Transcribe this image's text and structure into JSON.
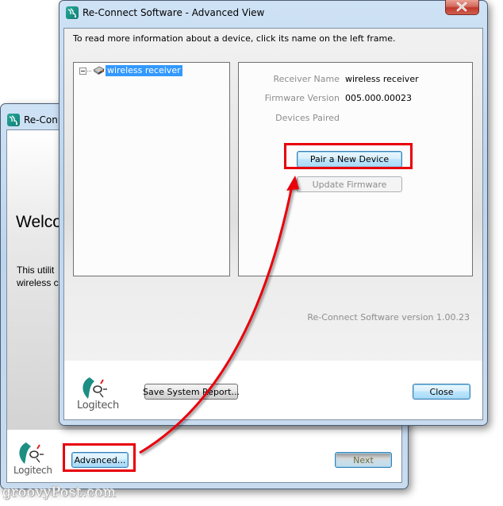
{
  "background_window": {
    "title": "Re-Connect Software",
    "title_visible": "Re-Conn",
    "welcome_heading_visible": "Welco",
    "body_line1_visible": "This utilit",
    "body_line2_visible": "wireless c",
    "advanced_button": "Advanced...",
    "next_button": "Next",
    "logo_text": "Logitech"
  },
  "advanced_window": {
    "title": "Re-Connect Software - Advanced View",
    "close_icon": "close-x-icon",
    "instruction": "To read more information about a device, click its name on the left frame.",
    "tree": {
      "items": [
        {
          "label": "wireless receiver",
          "icon": "usb-receiver-icon",
          "expanded": true,
          "selected": true
        }
      ]
    },
    "details": {
      "rows": [
        {
          "label": "Receiver Name",
          "value": "wireless receiver"
        },
        {
          "label": "Firmware Version",
          "value": "005.000.00023"
        },
        {
          "label": "Devices Paired",
          "value": ""
        }
      ],
      "pair_button": "Pair a New Device",
      "update_button": "Update Firmware"
    },
    "version_text": "Re-Connect Software version 1.00.23",
    "save_report_button": "Save System Report...",
    "close_button": "Close",
    "logo_text": "Logitech"
  },
  "annotation": {
    "highlight_color": "#e8000b",
    "arrow_from": "advanced-button",
    "arrow_to": "pair-new-device-button"
  },
  "watermark": "groovyPost.com",
  "colors": {
    "selection": "#3399ff",
    "frame": "#bcd5ee",
    "close_button": "#c8453c"
  }
}
